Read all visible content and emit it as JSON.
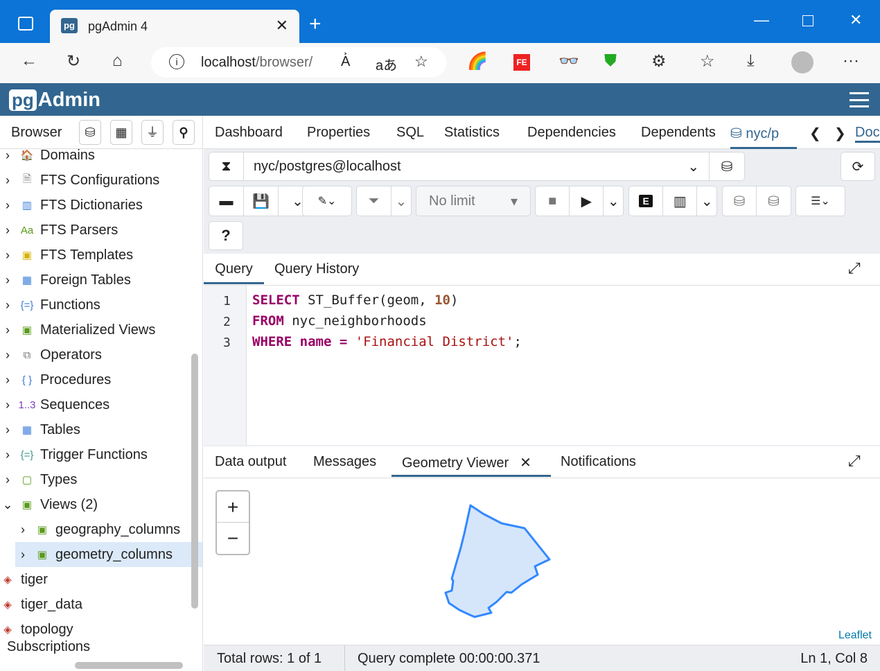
{
  "browser": {
    "tab_title": "pgAdmin 4",
    "url_host": "localhost",
    "url_path": "/browser/",
    "new_tab": "+"
  },
  "app": {
    "logo_pg": "pg",
    "logo_text": "Admin"
  },
  "left": {
    "title": "Browser",
    "tree": [
      {
        "label": "Domains",
        "icon": "domain-icon",
        "color": "#c0392b"
      },
      {
        "label": "FTS Configurations",
        "icon": "fts-config-icon",
        "color": "#777"
      },
      {
        "label": "FTS Dictionaries",
        "icon": "fts-dictionary-icon",
        "color": "#3b7dd8"
      },
      {
        "label": "FTS Parsers",
        "icon": "fts-parser-icon",
        "color": "#5a9a1a"
      },
      {
        "label": "FTS Templates",
        "icon": "fts-template-icon",
        "color": "#d4b400"
      },
      {
        "label": "Foreign Tables",
        "icon": "foreign-table-icon",
        "color": "#3b7dd8"
      },
      {
        "label": "Functions",
        "icon": "function-icon",
        "color": "#3b7dd8"
      },
      {
        "label": "Materialized Views",
        "icon": "materialized-view-icon",
        "color": "#5a9a1a"
      },
      {
        "label": "Operators",
        "icon": "operator-icon",
        "color": "#777"
      },
      {
        "label": "Procedures",
        "icon": "procedure-icon",
        "color": "#3b7dd8"
      },
      {
        "label": "Sequences",
        "icon": "sequence-icon",
        "color": "#7b3fb8"
      },
      {
        "label": "Tables",
        "icon": "table-icon",
        "color": "#3b7dd8"
      },
      {
        "label": "Trigger Functions",
        "icon": "trigger-function-icon",
        "color": "#3b9a8a"
      },
      {
        "label": "Types",
        "icon": "type-icon",
        "color": "#5a9a1a"
      },
      {
        "label": "Views (2)",
        "icon": "view-icon",
        "color": "#5a9a1a"
      }
    ],
    "views": [
      "geography_columns",
      "geometry_columns"
    ],
    "schemas": [
      "tiger",
      "tiger_data",
      "topology"
    ],
    "subscriptions": "Subscriptions",
    "icon_labels": {
      "pg": "1..3",
      "aa": "Aa"
    }
  },
  "main": {
    "tabs": [
      "Dashboard",
      "Properties",
      "SQL",
      "Statistics",
      "Dependencies",
      "Dependents"
    ],
    "active_tab": "nyc/p",
    "overflow_tab": "Doc"
  },
  "query_tool": {
    "connection": "nyc/postgres@localhost",
    "limit": "No limit",
    "explain": "E",
    "tabs": [
      "Query",
      "Query History"
    ],
    "code": [
      [
        "SELECT",
        " ST_Buffer(geom, ",
        "10",
        ")"
      ],
      [
        "FROM",
        " nyc_neighborhoods"
      ],
      [
        "WHERE",
        " name = ",
        "'Financial District'",
        ";"
      ]
    ],
    "line_numbers": [
      "1",
      "2",
      "3"
    ]
  },
  "output": {
    "tabs": [
      "Data output",
      "Messages",
      "Geometry Viewer",
      "Notifications"
    ],
    "active": "Geometry Viewer",
    "zoom_in": "+",
    "zoom_out": "−",
    "attribution": "Leaflet",
    "fill": "#d5e6fb",
    "stroke": "#3388ff"
  },
  "status": {
    "rows": "Total rows: 1 of 1",
    "query": "Query complete 00:00:00.371",
    "cursor": "Ln 1, Col 8"
  }
}
